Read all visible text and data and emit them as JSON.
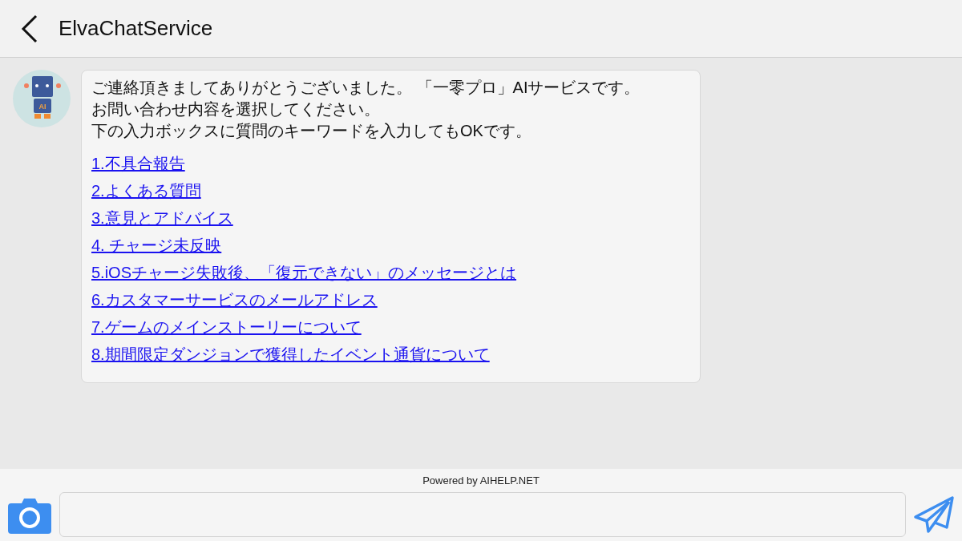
{
  "header": {
    "title": "ElvaChatService"
  },
  "message": {
    "avatar_label": "AI",
    "lines": [
      "ご連絡頂きましてありがとうございました。 「一零プロ」AIサービスです。",
      "お問い合わせ内容を選択してください。",
      "下の入力ボックスに質問のキーワードを入力してもOKです。"
    ],
    "options": [
      "1.不具合報告",
      "2.よくある質問",
      "3.意見とアドバイス",
      "4. チャージ未反映",
      "5.iOSチャージ失敗後、「復元できない」のメッセージとは",
      "6.カスタマーサービスのメールアドレス",
      "7.ゲームのメインストーリーについて",
      "8.期間限定ダンジョンで獲得したイベント通貨について"
    ]
  },
  "footer": {
    "powered_by": "Powered by AIHELP.NET"
  }
}
